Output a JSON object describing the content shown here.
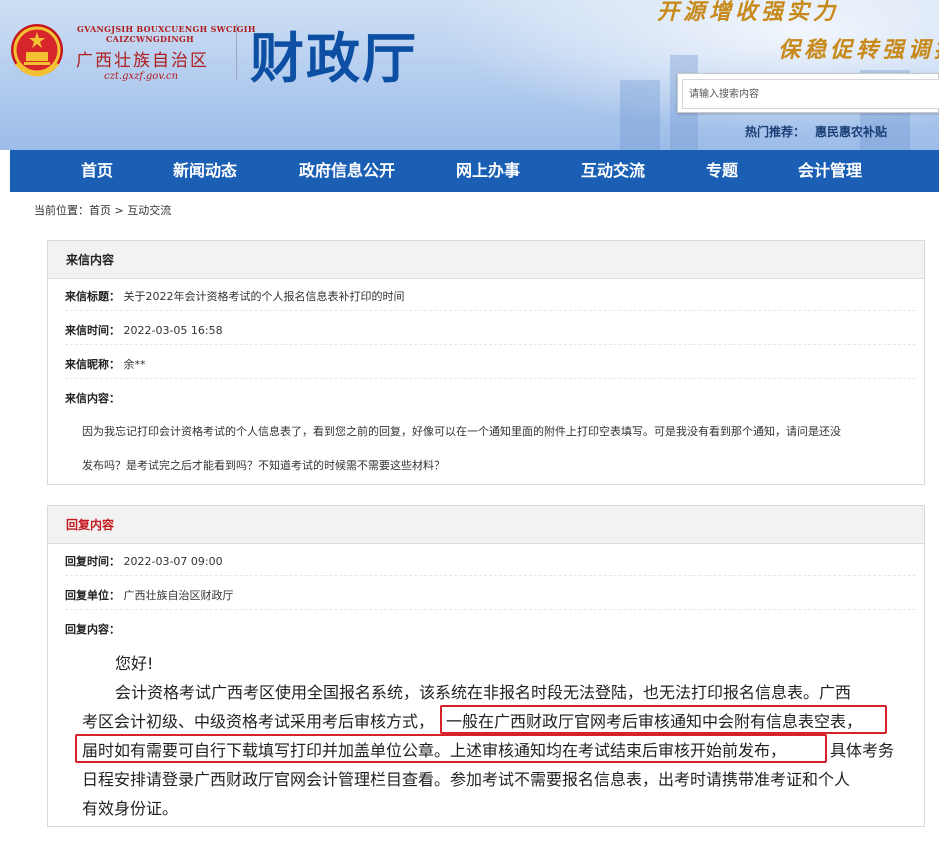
{
  "header": {
    "pinyin_line1": "GVANGJSIH BOUXCUENGH SWCIGIH",
    "pinyin_line2": "CAIZCWNGDINGH",
    "region_name": "广西壮族自治区",
    "site_url": "czt.gxzf.gov.cn",
    "department": "财政厅",
    "slogan1": "开源增收强实力",
    "slogan2": "保稳促转强调控",
    "search_placeholder": "请输入搜索内容",
    "hot_label": "热门推荐：",
    "hot_items": [
      "惠民惠农补贴"
    ]
  },
  "nav": {
    "items": [
      "首页",
      "新闻动态",
      "政府信息公开",
      "网上办事",
      "互动交流",
      "专题",
      "会计管理"
    ]
  },
  "breadcrumb": {
    "prefix": "当前位置：",
    "home": "首页",
    "sep": ">",
    "current": "互动交流"
  },
  "letter": {
    "section_title": "来信内容",
    "title_key": "来信标题：",
    "title_val": "关于2022年会计资格考试的个人报名信息表补打印的时间",
    "time_key": "来信时间：",
    "time_val": "2022-03-05 16:58",
    "nick_key": "来信昵称：",
    "nick_val": "余**",
    "content_key": "来信内容：",
    "content_line1": "因为我忘记打印会计资格考试的个人信息表了，看到您之前的回复，好像可以在一个通知里面的附件上打印空表填写。可是我没有看到那个通知，请问是还没",
    "content_line2": "发布吗？是考试完之后才能看到吗？不知道考试的时候需不需要这些材料？"
  },
  "reply": {
    "section_title": "回复内容",
    "time_key": "回复时间：",
    "time_val": "2022-03-07 09:00",
    "unit_key": "回复单位：",
    "unit_val": "广西壮族自治区财政厅",
    "content_key": "回复内容：",
    "greeting": "您好!",
    "line1": "会计资格考试广西考区使用全国报名系统，该系统在非报名时段无法登陆，也无法打印报名信息表。广西",
    "line2a": "考区会计初级、中级资格考试采用考后审核方式，",
    "line2b": "一般在广西财政厅官网考后审核通知中会附有信息表空表，",
    "line3a": "届时如有需要可自行下载填写打印并加盖单位公章。上述审核通知均在考试结束后审核开始前发布，",
    "line3b": "具体考务",
    "line4": "日程安排请登录广西财政厅官网会计管理栏目查看。参加考试不需要报名信息表，出考时请携带准考证和个人",
    "line5": "有效身份证。"
  },
  "colors": {
    "nav_bg": "#1b5fb5",
    "dept_blue": "#0d4fa3",
    "logo_red": "#b11c1c",
    "highlight_red": "#d9212a",
    "slogan_gold": "#c78a1a"
  }
}
